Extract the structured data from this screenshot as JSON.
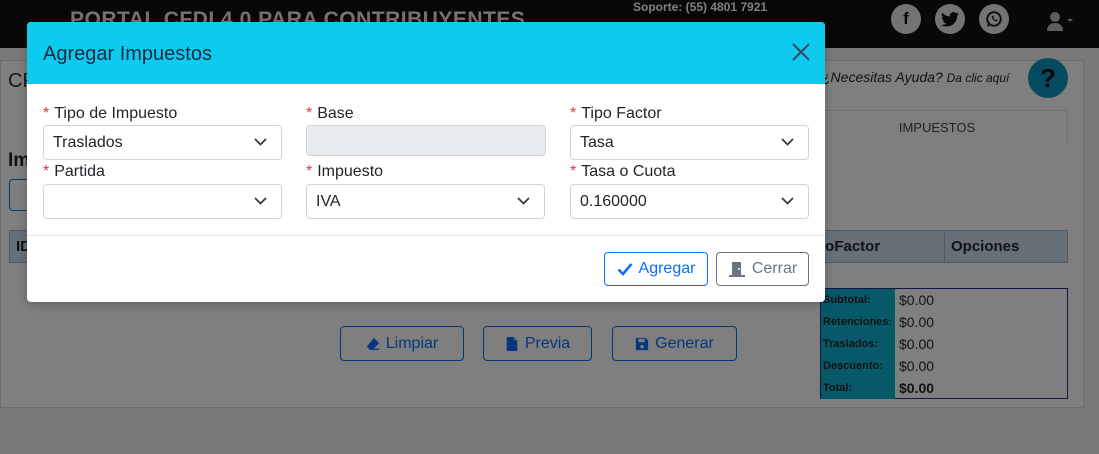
{
  "portal": {
    "brand": "PORTAL CFDI 4.0 PARA CONTRIBUYENTES",
    "support": "Soporte: (55) 4801 7921",
    "page_title": "CF",
    "help_question": "¿Necesitas Ayuda?",
    "help_link": "Da clic aquí",
    "help_button": "?",
    "tab_impuestos": "IMPUESTOS",
    "section_label": "Im",
    "grid_headers": {
      "id": "ID",
      "tipo_factor": "poFactor",
      "opciones": "Opciones"
    },
    "buttons": {
      "limpiar": "Limpiar",
      "previa": "Previa",
      "generar": "Generar"
    },
    "totals": [
      {
        "label": "Subtotal:",
        "value": "$0.00"
      },
      {
        "label": "Retenciones:",
        "value": "$0.00"
      },
      {
        "label": "Traslados:",
        "value": "$0.00"
      },
      {
        "label": "Descuento:",
        "value": "$0.00"
      },
      {
        "label": "Total:",
        "value": "$0.00"
      }
    ],
    "social_icons": [
      "facebook-icon",
      "twitter-icon",
      "whatsapp-icon"
    ]
  },
  "modal": {
    "title": "Agregar Impuestos",
    "required_mark": "*",
    "fields": {
      "tipo_impuesto": {
        "label": "Tipo de Impuesto",
        "value": "Traslados"
      },
      "base": {
        "label": "Base",
        "value": ""
      },
      "tipo_factor": {
        "label": "Tipo Factor",
        "value": "Tasa"
      },
      "partida": {
        "label": "Partida",
        "value": ""
      },
      "impuesto": {
        "label": "Impuesto",
        "value": "IVA"
      },
      "tasa_cuota": {
        "label": "Tasa o Cuota",
        "value": "0.160000"
      }
    },
    "buttons": {
      "agregar": "Agregar",
      "cerrar": "Cerrar"
    }
  },
  "colors": {
    "header": "#0ccbee",
    "primary": "#0d6efd",
    "secondary": "#6c757d",
    "required": "#dc3545",
    "totals_label": "#0fb2d4"
  }
}
